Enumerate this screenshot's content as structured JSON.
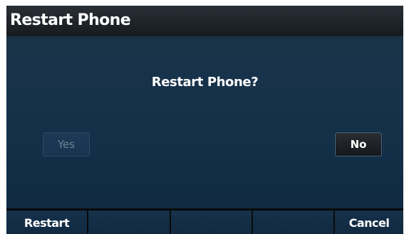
{
  "header": {
    "title": "Restart Phone"
  },
  "dialog": {
    "prompt": "Restart Phone?",
    "yes_label": "Yes",
    "no_label": "No",
    "yes_enabled": false,
    "selected": "No"
  },
  "softkeys": [
    {
      "label": "Restart"
    },
    {
      "label": ""
    },
    {
      "label": ""
    },
    {
      "label": ""
    },
    {
      "label": "Cancel"
    }
  ],
  "colors": {
    "title_bar": "#1f242a",
    "panel": "#17324a",
    "softkey": "#16314a",
    "text": "#ffffff",
    "disabled_text": "#6d8396"
  }
}
